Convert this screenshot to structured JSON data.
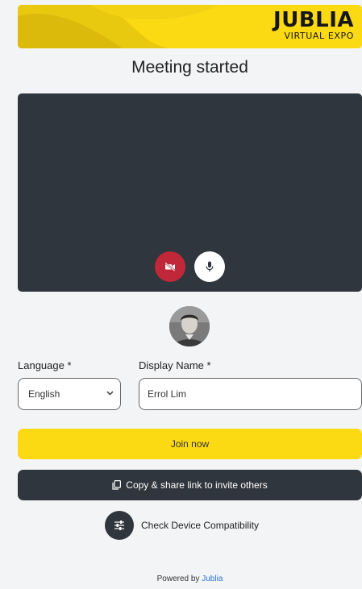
{
  "banner": {
    "logo_main": "JUBLIA",
    "logo_sub": "VIRTUAL EXPO",
    "color": "#fbd913"
  },
  "page": {
    "title": "Meeting started"
  },
  "video": {
    "background": "#30363d",
    "camera_icon": "video-off-icon",
    "mic_icon": "microphone-icon"
  },
  "form": {
    "language_label": "Language *",
    "language_value": "English",
    "display_name_label": "Display Name *",
    "display_name_value": "Errol Lim"
  },
  "actions": {
    "join_label": "Join now",
    "share_label": "Copy & share link to invite others",
    "compat_label": "Check Device Compatibility"
  },
  "footer": {
    "powered_by": "Powered by",
    "brand": "Jublia"
  },
  "colors": {
    "accent": "#fbd913",
    "dark": "#30363d",
    "danger": "#c0283a",
    "link": "#2d74d6"
  }
}
